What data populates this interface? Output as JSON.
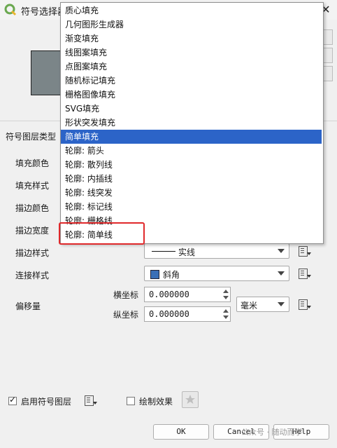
{
  "window": {
    "title": "符号选择器",
    "close": "✕"
  },
  "dropdown": {
    "items": [
      "质心填充",
      "几何图形生成器",
      "渐变填充",
      "线图案填充",
      "点图案填充",
      "随机标记填充",
      "栅格图像填充",
      "SVG填充",
      "形状突发填充",
      "简单填充",
      "轮廓: 箭头",
      "轮廓: 散列线",
      "轮廓: 内插线",
      "轮廓: 线突发",
      "轮廓: 标记线",
      "轮廓: 栅格线",
      "轮廓: 简单线"
    ],
    "selected": "简单填充",
    "highlighted": "轮廓: 简单线"
  },
  "labels": {
    "layer_type": "符号图层类型",
    "fill_color": "填充颜色",
    "fill_style": "填充样式",
    "stroke_color": "描边颜色",
    "stroke_width": "描边宽度",
    "stroke_style": "描边样式",
    "join_style": "连接样式",
    "offset": "偏移量",
    "x": "横坐标",
    "y": "纵坐标"
  },
  "fields": {
    "stroke_style": "实线",
    "join_style": "斜角",
    "offset_x": "0.000000",
    "offset_y": "0.000000",
    "unit": "毫米"
  },
  "bottom": {
    "enable_layer": "启用符号图层",
    "enable_checked": true,
    "draw_effects": "绘制效果",
    "ok": "OK",
    "cancel": "Cancel",
    "help": "Help"
  },
  "watermark": "公众号 · 随动而学",
  "colors": {
    "accent": "#2c64c8",
    "highlight_box": "#e0292b",
    "preview_fill": "#7b8588"
  }
}
